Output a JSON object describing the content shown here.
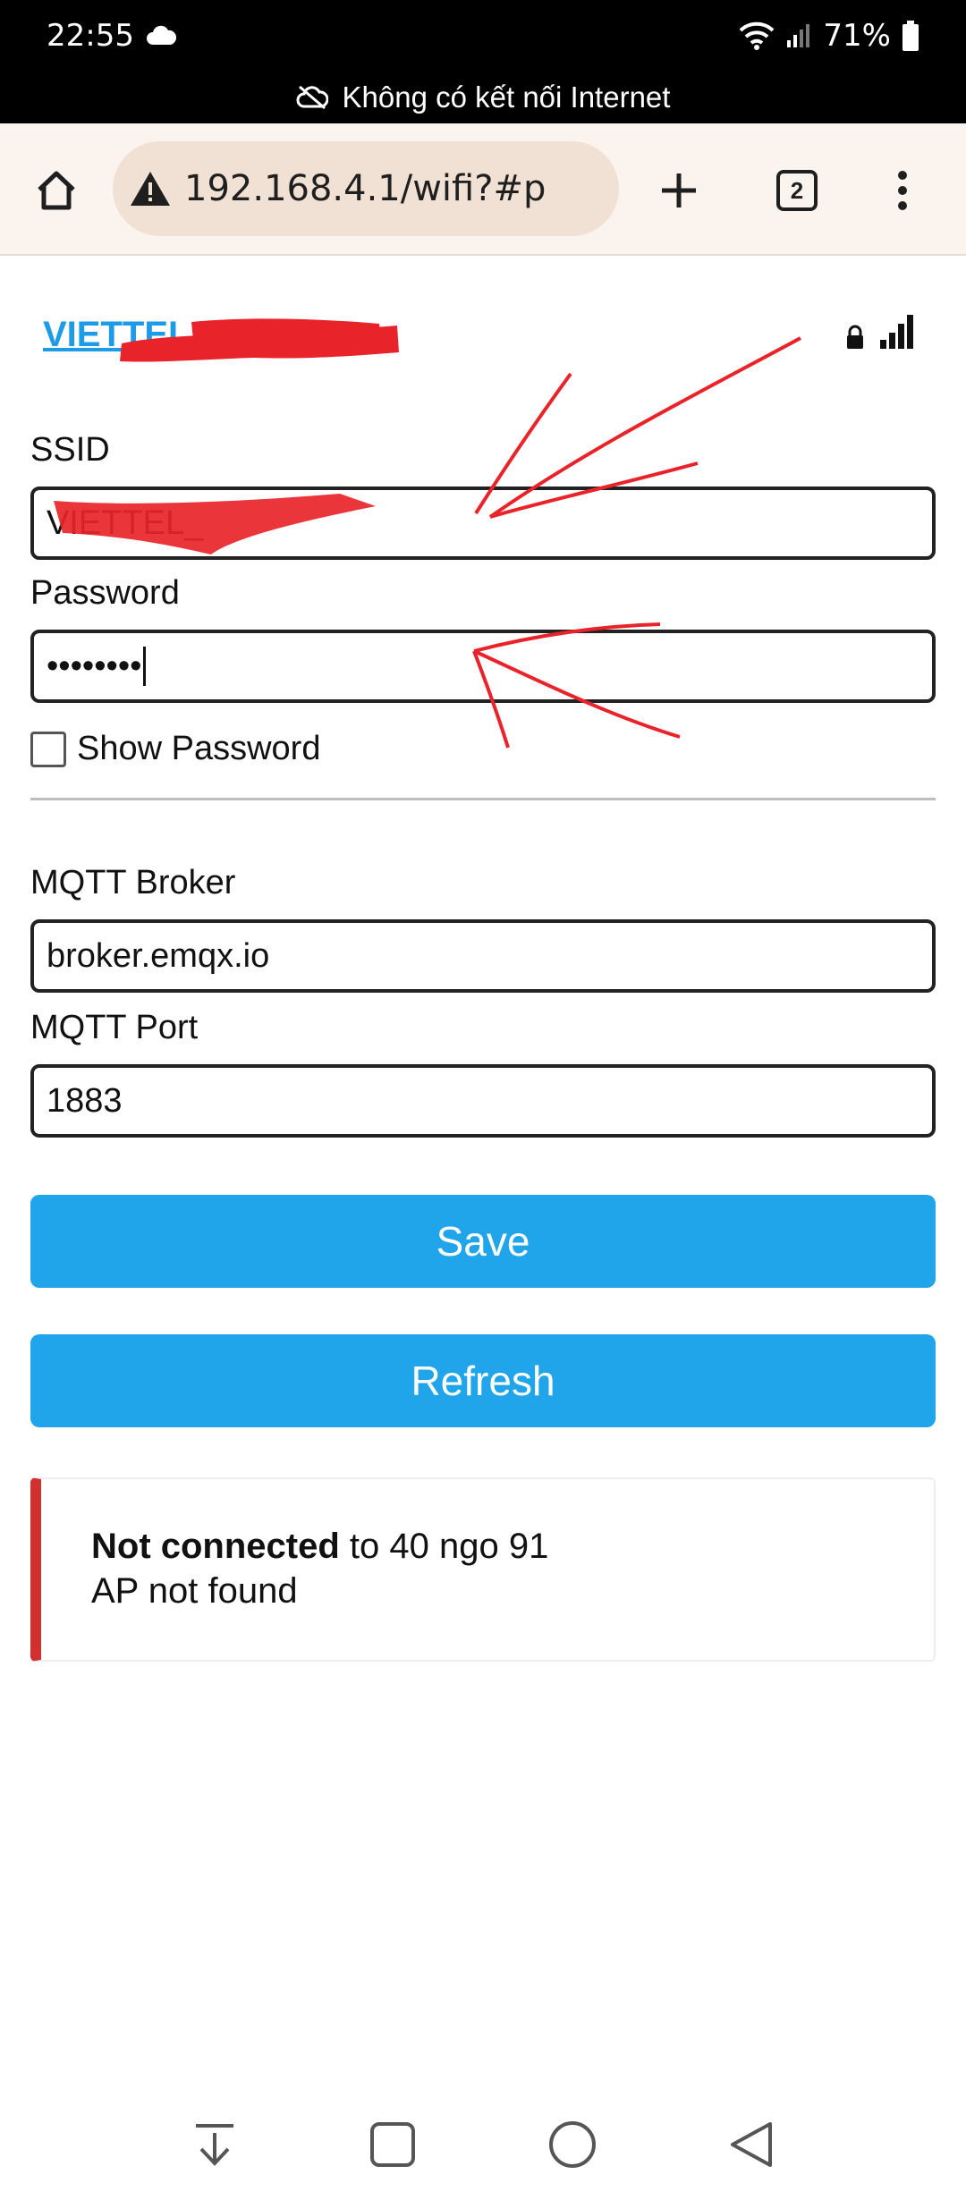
{
  "status_bar": {
    "time": "22:55",
    "battery": "71%",
    "icons": [
      "cloud-icon",
      "wifi-icon",
      "signal-icon",
      "battery-icon"
    ]
  },
  "offline_banner": {
    "text": "Không có kết nối Internet"
  },
  "browser": {
    "url": "192.168.4.1/wifi?#p",
    "tab_count": "2"
  },
  "network": {
    "name": "VIETTEL_"
  },
  "form": {
    "ssid_label": "SSID",
    "ssid_value": "VIETTEL_",
    "password_label": "Password",
    "password_value": "••••••••",
    "show_password_label": "Show Password",
    "mqtt_broker_label": "MQTT Broker",
    "mqtt_broker_value": "broker.emqx.io",
    "mqtt_port_label": "MQTT Port",
    "mqtt_port_value": "1883",
    "save_label": "Save",
    "refresh_label": "Refresh"
  },
  "status": {
    "bold": "Not connected",
    "rest": " to 40 ngo 91",
    "line2": "AP not found"
  },
  "colors": {
    "accent": "#20a4ea",
    "error": "#d03030",
    "link": "#1e9be6",
    "annotation": "#e8242a"
  }
}
